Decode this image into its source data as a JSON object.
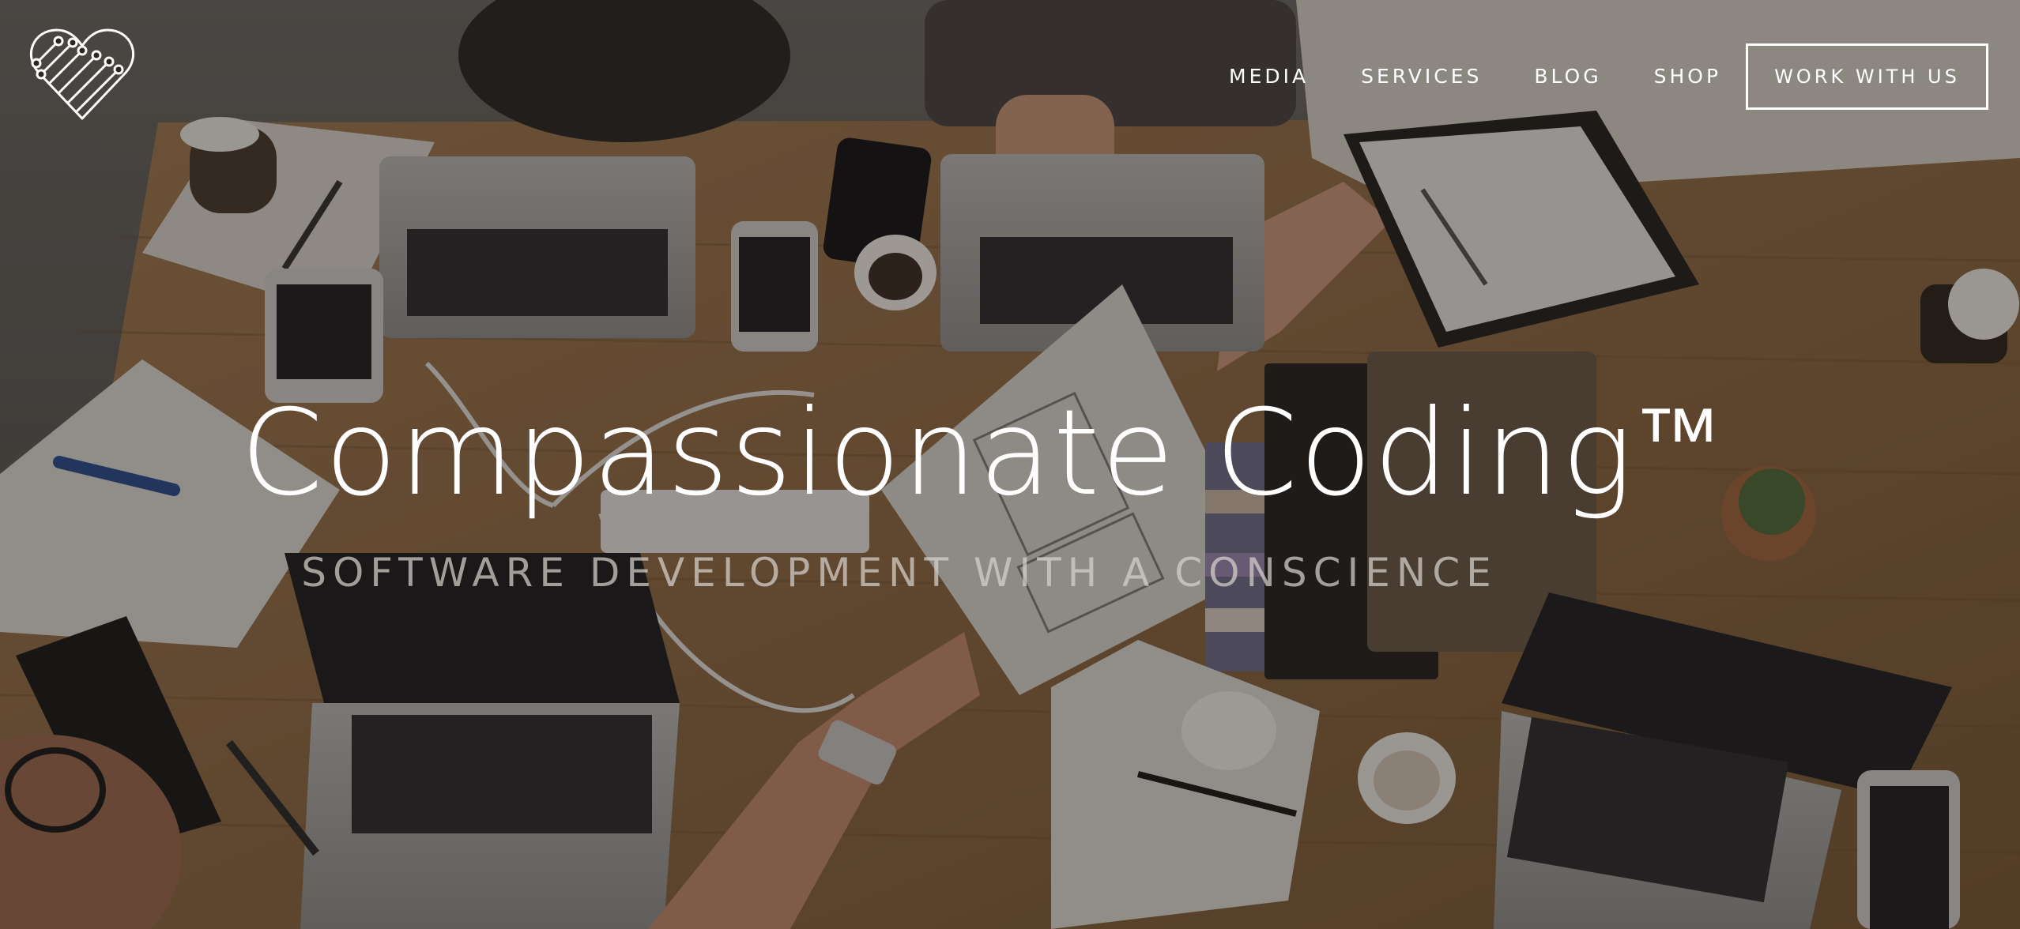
{
  "site": {
    "logo_icon": "circuit-heart-icon"
  },
  "nav": {
    "items": [
      {
        "label": "MEDIA"
      },
      {
        "label": "SERVICES"
      },
      {
        "label": "BLOG"
      },
      {
        "label": "SHOP"
      }
    ],
    "cta_label": "WORK WITH US"
  },
  "hero": {
    "title": "Compassionate Coding",
    "title_mark": "™",
    "subtitle": "SOFTWARE DEVELOPMENT WITH A CONSCIENCE"
  },
  "colors": {
    "text": "#ffffff",
    "subtitle": "#d7d2cd",
    "overlay": "#14100e"
  }
}
